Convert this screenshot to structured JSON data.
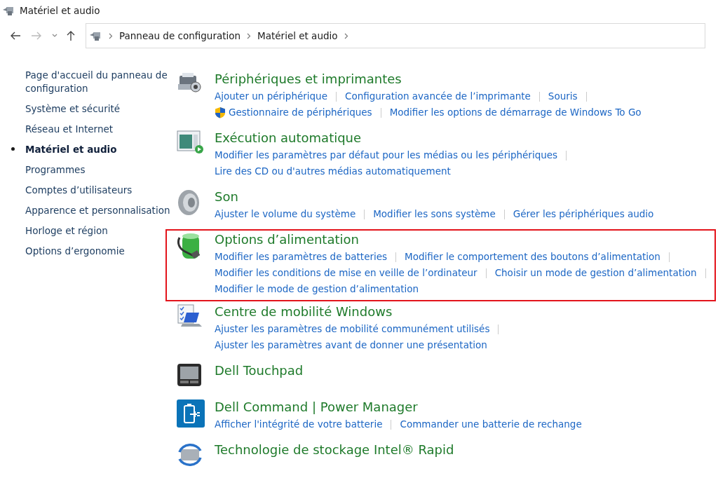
{
  "window": {
    "title": "Matériel et audio"
  },
  "address_bar": {
    "breadcrumbs": [
      "Panneau de configuration",
      "Matériel et audio"
    ]
  },
  "sidebar": {
    "items": [
      {
        "label": "Page d'accueil du panneau de configuration",
        "selected": false
      },
      {
        "label": "Système et sécurité",
        "selected": false
      },
      {
        "label": "Réseau et Internet",
        "selected": false
      },
      {
        "label": "Matériel et audio",
        "selected": true
      },
      {
        "label": "Programmes",
        "selected": false
      },
      {
        "label": "Comptes d’utilisateurs",
        "selected": false
      },
      {
        "label": "Apparence et personnalisation",
        "selected": false
      },
      {
        "label": "Horloge et région",
        "selected": false
      },
      {
        "label": "Options d’ergonomie",
        "selected": false
      }
    ]
  },
  "sections": [
    {
      "kind": "devices",
      "title": "Périphériques et imprimantes",
      "highlighted": false,
      "lines": [
        [
          {
            "text": "Ajouter un périphérique",
            "shield": false
          },
          {
            "text": "Configuration avancée de l’imprimante",
            "shield": false
          },
          {
            "text": "Souris",
            "shield": false
          }
        ],
        [
          {
            "text": "Gestionnaire de périphériques",
            "shield": true
          },
          {
            "text": "Modifier les options de démarrage de Windows To Go",
            "shield": false
          }
        ]
      ]
    },
    {
      "kind": "autoplay",
      "title": "Exécution automatique",
      "highlighted": false,
      "lines": [
        [
          {
            "text": "Modifier les paramètres par défaut pour les médias ou les périphériques",
            "shield": false
          }
        ],
        [
          {
            "text": "Lire des CD ou d'autres médias automatiquement",
            "shield": false
          }
        ]
      ]
    },
    {
      "kind": "sound",
      "title": "Son",
      "highlighted": false,
      "lines": [
        [
          {
            "text": "Ajuster le volume du système",
            "shield": false
          },
          {
            "text": "Modifier les sons système",
            "shield": false
          },
          {
            "text": "Gérer les périphériques audio",
            "shield": false
          }
        ]
      ]
    },
    {
      "kind": "power",
      "title": "Options d’alimentation",
      "highlighted": true,
      "lines": [
        [
          {
            "text": "Modifier les paramètres de batteries",
            "shield": false
          },
          {
            "text": "Modifier le comportement des boutons d’alimentation",
            "shield": false
          }
        ],
        [
          {
            "text": "Modifier les conditions de mise en veille de l’ordinateur",
            "shield": false
          },
          {
            "text": "Choisir un mode de gestion d’alimentation",
            "shield": false
          }
        ],
        [
          {
            "text": "Modifier le mode de gestion d’alimentation",
            "shield": false
          }
        ]
      ]
    },
    {
      "kind": "mobility",
      "title": "Centre de mobilité Windows",
      "highlighted": false,
      "lines": [
        [
          {
            "text": "Ajuster les paramètres de mobilité communément utilisés",
            "shield": false
          }
        ],
        [
          {
            "text": "Ajuster les paramètres avant de donner une présentation",
            "shield": false
          }
        ]
      ]
    },
    {
      "kind": "touchpad",
      "title": "Dell Touchpad",
      "highlighted": false
    },
    {
      "kind": "dellpower",
      "title": "Dell Command | Power Manager",
      "highlighted": false,
      "lines": [
        [
          {
            "text": "Afficher l'intégrité de votre batterie",
            "shield": false
          },
          {
            "text": "Commander une batterie de rechange",
            "shield": false
          }
        ]
      ]
    },
    {
      "kind": "storage",
      "title": "Technologie de stockage Intel® Rapid",
      "highlighted": false
    }
  ]
}
